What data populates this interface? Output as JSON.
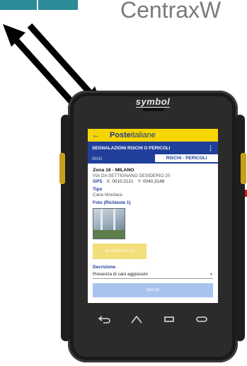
{
  "slide": {
    "title": "CentraxW"
  },
  "device": {
    "brand": "symbol"
  },
  "app": {
    "logo_bold": "Poste",
    "logo_light": "italiane",
    "back_icon": "arrow-left-icon",
    "screen_title": "SEGNALAZIONI RISCHI O PERICOLI",
    "menu_icon": "more-vertical-icon",
    "tabs": [
      {
        "label": "MAG",
        "active": false
      },
      {
        "label": "RISCHI - PERICOLI",
        "active": true
      }
    ],
    "zona": "Zona 16 - MILANO",
    "address": "VIA DA SETTIGNANO DESIDERIO 20",
    "gps": {
      "label": "GPS",
      "x": "X: 0010.2121",
      "y": "Y: 0040,3148"
    },
    "tipo_label": "Tipo",
    "tipo_value": "Cane Mordace",
    "foto_label": "Foto (Richieste 1)",
    "allega_label": "ALLEGA FOTO",
    "descrizione_label": "Decrizione",
    "descrizione_value": "Presenza di cani aggressivi",
    "salva_label": "SALVA"
  },
  "colors": {
    "app_yellow": "#f6d600",
    "app_blue": "#1f3f9a",
    "salva_blue": "#a9c3ef",
    "allega_yellow": "#f2df7a",
    "badge_teal": "#2e8b99"
  },
  "navbar": {
    "icons": [
      "back-nav-icon",
      "home-nav-icon",
      "menu-nav-icon",
      "recent-apps-icon"
    ]
  }
}
